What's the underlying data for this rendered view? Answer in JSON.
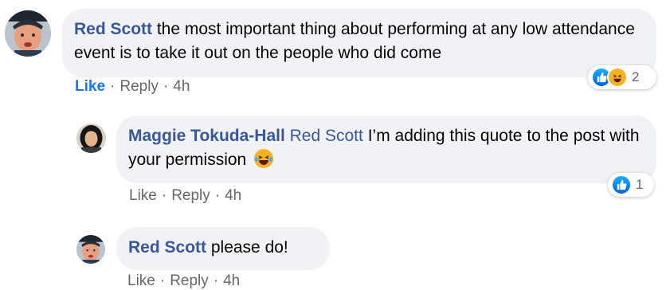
{
  "comments": [
    {
      "author": "Red Scott",
      "text": " the most important thing about performing at any low attendance event is to take it out on the people who did come",
      "actions": {
        "like": "Like",
        "reply": "Reply",
        "time": "4h"
      },
      "reactions": {
        "count": "2",
        "icons": [
          "like-icon",
          "haha-icon"
        ]
      }
    },
    {
      "author": "Maggie Tokuda-Hall",
      "mention": "Red Scott",
      "text": " I’m adding this quote to the post with your permission",
      "inline_emoji": "tears-of-joy-emoji",
      "actions": {
        "like": "Like",
        "reply": "Reply",
        "time": "4h"
      },
      "reactions": {
        "count": "1",
        "icons": [
          "like-icon"
        ]
      }
    },
    {
      "author": "Red Scott",
      "text": " please do!",
      "actions": {
        "like": "Like",
        "reply": "Reply",
        "time": "4h"
      }
    }
  ],
  "separator": "·",
  "colors": {
    "name": "#385898",
    "liked": "#1877f2",
    "bubble": "#f0f2f5",
    "meta": "#65676b"
  }
}
